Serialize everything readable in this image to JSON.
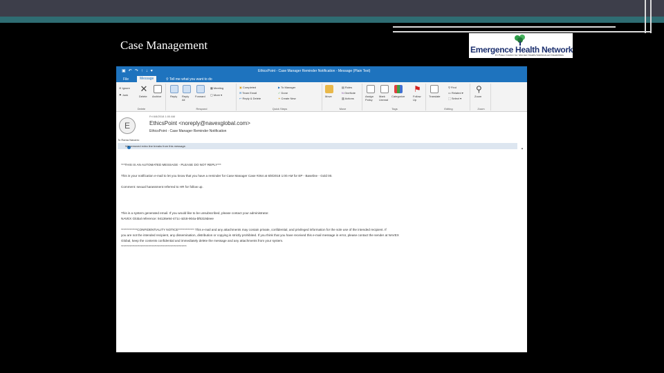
{
  "slide": {
    "title": "Case Management",
    "logo": {
      "name": "Emergence Health Network",
      "tagline": "El Paso Center for Mental Health/Intellectual Disabilities"
    }
  },
  "window": {
    "title": "EthicsPoint - Case Manager Reminder Notification  -  Message (Plain Text)",
    "tabs": [
      "File",
      "Message",
      "Tell me what you want to do"
    ]
  },
  "ribbon": {
    "delete": {
      "ignore": "Ignore",
      "junk": "Junk",
      "delete": "Delete",
      "archive": "Archive",
      "label": "Delete"
    },
    "respond": {
      "reply": "Reply",
      "reply_all": "Reply All",
      "forward": "Forward",
      "meeting": "Meeting",
      "more": "More",
      "label": "Respond"
    },
    "quick_steps": {
      "items": [
        "Completed",
        "To Manager",
        "Team Email",
        "Done",
        "Reply & Delete",
        "Create New"
      ],
      "label": "Quick Steps"
    },
    "move": {
      "move": "Move",
      "rules": "Rules",
      "onenote": "OneNote",
      "actions": "Actions",
      "label": "Move"
    },
    "tags": {
      "assign": "Assign Policy",
      "mark": "Mark Unread",
      "categorize": "Categorize",
      "follow": "Follow Up",
      "label": "Tags"
    },
    "editing": {
      "translate": "Translate",
      "find": "Find",
      "related": "Related",
      "select": "Select",
      "label": "Editing"
    },
    "zoom": {
      "zoom": "Zoom",
      "label": "Zoom"
    }
  },
  "message": {
    "avatar": "E",
    "date": "Fri 6/8/2018 1:00 AM",
    "from": "EthicsPoint <noreply@navexglobal.com>",
    "subject": "EthicsPoint - Case Manager Reminder Notification",
    "to": "To   Rama Navarro",
    "info": "We removed extra line breaks from this message.",
    "body": [
      "***THIS IS AN AUTOMATED MESSAGE - PLEASE DO NOT REPLY***",
      "This is your notification e-mail to let you know that you have a reminder for Case Manager Case #264 at 6/8/2018 1:00 AM for EP - Baseline - Gold 00.",
      "Comment: sexual harassment referred to HR for follow up.",
      "This is a system generated email. If you would like to be unsubscribed, please contact your administrator.",
      "NAVEX Global reference: 94136e94-471c-4dc8-904a-bf6319deee",
      "*************CONFIDENTIALITY NOTICE************* This e-mail and any attachments may contain private, confidential, and privileged information for the sole use of the intended recipient. If",
      "you are not the intended recipient, any dissemination, distribution or copying is strictly prohibited. If you think that you have received this e-mail message in error, please contact the sender at NAVEX",
      "Global, keep the contents confidential and immediately delete the message and any attachments from your system.",
      "*****************************************************"
    ]
  }
}
